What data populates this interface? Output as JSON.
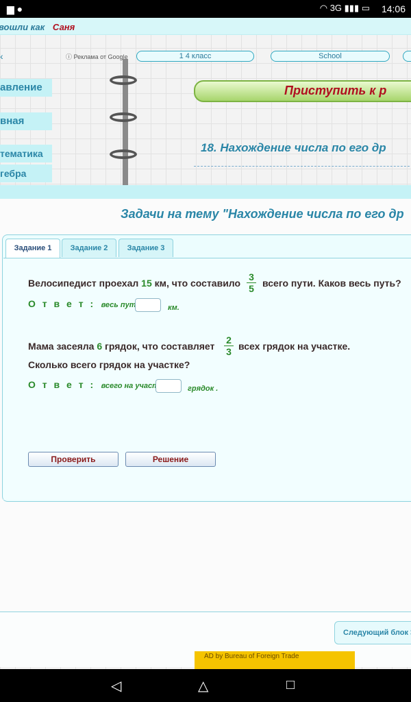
{
  "status_bar": {
    "network": "3G",
    "time": "14:06"
  },
  "header": {
    "login_text": "вошли как",
    "user_name": "Саня",
    "ad_label": "Реклама от Google"
  },
  "nav_pills": [
    "1 4 класс",
    "School"
  ],
  "sidebar": {
    "items": [
      "авление",
      "вная",
      "тематика",
      "гебра"
    ]
  },
  "start_button": "Приступить к р",
  "lesson_title": "18. Нахождение числа по его др",
  "panel_title": "Задачи на тему \"Нахождение числа по его др",
  "tabs": [
    {
      "label": "Задание 1",
      "active": true
    },
    {
      "label": "Задание 2",
      "active": false
    },
    {
      "label": "Задание 3",
      "active": false
    }
  ],
  "task1": {
    "text_before": "Велосипедист проехал ",
    "number": "15",
    "text_mid": " км, что составило",
    "frac_num": "3",
    "frac_den": "5",
    "text_after": "всего пути.  Каков весь путь?",
    "answer_label": "О т в е т :",
    "answer_prefix": "весь путь    =",
    "answer_unit": "км."
  },
  "task2": {
    "text_before": "Мама засеяла ",
    "number": "6",
    "text_mid": " грядок, что составляет",
    "frac_num": "2",
    "frac_den": "3",
    "text_after": "всех грядок на участке.",
    "line2": "Сколько всего грядок на участке?",
    "answer_label": "О т в е т :",
    "answer_prefix": "всего на участке",
    "answer_unit": "грядок ."
  },
  "buttons": {
    "check": "Проверить",
    "solution": "Решение"
  },
  "next_block": "Следующий блок >",
  "bottom_ad": "AD by Bureau of Foreign Trade"
}
